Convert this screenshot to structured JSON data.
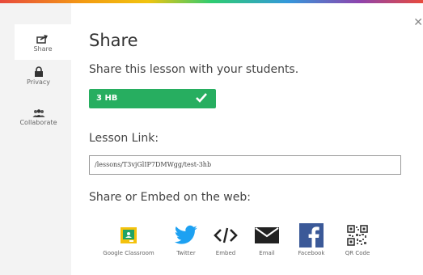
{
  "sidebar": {
    "items": [
      {
        "label": "Share",
        "icon": "share-icon"
      },
      {
        "label": "Privacy",
        "icon": "lock-icon"
      },
      {
        "label": "Collaborate",
        "icon": "people-icon"
      }
    ]
  },
  "dialog": {
    "title": "Share",
    "subtitle": "Share this lesson with your students.",
    "class_button_label": "3 HB",
    "lesson_link_label": "Lesson Link:",
    "lesson_link_value": "/lessons/T3vjGlIP7DMWgg/test-3hb",
    "web_label": "Share or Embed on the web:"
  },
  "share_options": [
    {
      "label": "Google Classroom",
      "icon": "google-classroom-icon"
    },
    {
      "label": "Twitter",
      "icon": "twitter-icon"
    },
    {
      "label": "Embed",
      "icon": "embed-code-icon"
    },
    {
      "label": "Email",
      "icon": "email-icon"
    },
    {
      "label": "Facebook",
      "icon": "facebook-icon"
    },
    {
      "label": "QR Code",
      "icon": "qr-code-icon"
    }
  ],
  "colors": {
    "accent_green": "#27ae60",
    "sidebar_bg": "#f3f3f3",
    "twitter_blue": "#1da1f2",
    "facebook_blue": "#3b5998"
  }
}
